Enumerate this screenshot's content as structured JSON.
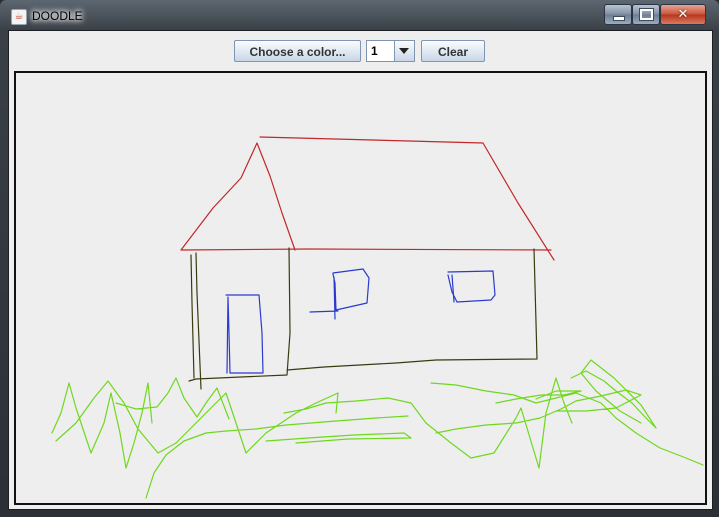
{
  "window": {
    "title": "DOODLE",
    "app_icon": "java-icon",
    "controls": {
      "minimize_icon": "minimize-icon",
      "maximize_icon": "maximize-icon",
      "close_icon": "close-icon",
      "close_glyph": "✕"
    }
  },
  "toolbar": {
    "choose_color_label": "Choose a color...",
    "stroke_size_value": "1",
    "clear_label": "Clear"
  },
  "drawing": {
    "colors": {
      "roof": "#c0282a",
      "walls": "#3a3a10",
      "windows": "#2a3ad0",
      "grass": "#6fd81e"
    }
  }
}
